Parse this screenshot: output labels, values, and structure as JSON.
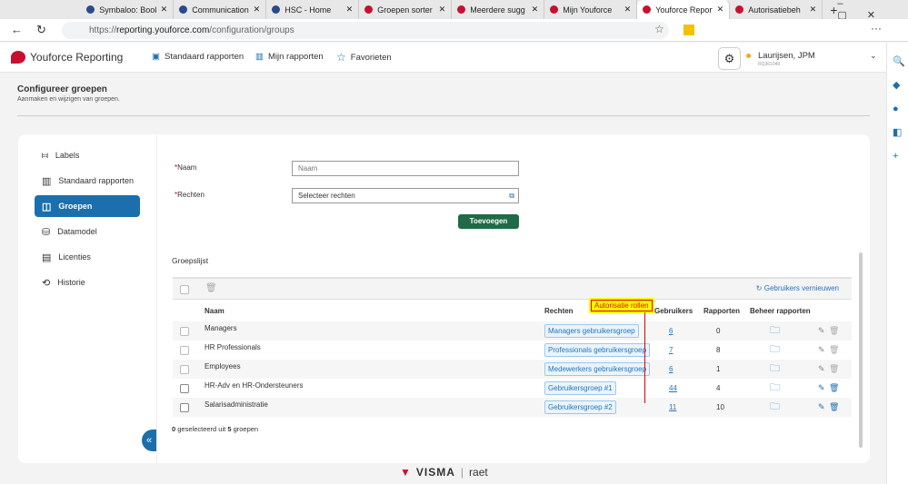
{
  "browser": {
    "tabs": [
      {
        "label": "Symbaloo: Book"
      },
      {
        "label": "Communication"
      },
      {
        "label": "HSC - Home"
      },
      {
        "label": "Groepen sorter"
      },
      {
        "label": "Meerdere sugg"
      },
      {
        "label": "Mijn Youforce"
      },
      {
        "label": "Youforce Report",
        "active": true
      },
      {
        "label": "Autorisatiebeh"
      }
    ],
    "url_prefix": "https://",
    "url_host": "reporting.youforce.com",
    "url_path": "/configuration/groups"
  },
  "app": {
    "logo": "Youforce Reporting",
    "nav": [
      "Standaard rapporten",
      "Mijn rapporten",
      "Favorieten"
    ],
    "user_name": "Laurijsen, JPM",
    "user_id": "RQ361049"
  },
  "page": {
    "title": "Configureer groepen",
    "subtitle": "Aanmaken en wijzigen van groepen."
  },
  "sidebar": {
    "items": [
      {
        "label": "Labels"
      },
      {
        "label": "Standaard rapporten"
      },
      {
        "label": "Groepen"
      },
      {
        "label": "Datamodel"
      },
      {
        "label": "Licenties"
      },
      {
        "label": "Historie"
      }
    ]
  },
  "form": {
    "name_label": "Naam",
    "name_placeholder": "Naam",
    "rights_label": "Rechten",
    "rights_placeholder": "Selecteer rechten",
    "required_mark": "*",
    "add_button": "Toevoegen"
  },
  "list": {
    "title": "Groepslijst",
    "refresh": "Gebruikers vernieuwen",
    "columns": [
      "Naam",
      "Rechten",
      "Gebruikers",
      "Rapporten",
      "Beheer rapporten"
    ],
    "rows": [
      {
        "name": "Managers",
        "rights": "Managers gebruikersgroep",
        "users": "6",
        "reports": "0"
      },
      {
        "name": "HR Professionals",
        "rights": "Professionals gebruikersgroep",
        "users": "7",
        "reports": "8"
      },
      {
        "name": "Employees",
        "rights": "Medewerkers gebruikersgroep",
        "users": "6",
        "reports": "1"
      },
      {
        "name": "HR-Adv en HR-Ondersteuners",
        "rights": "Gebruikersgroep #1",
        "users": "44",
        "reports": "4"
      },
      {
        "name": "Salarisadministratie",
        "rights": "Gebruikersgroep #2",
        "users": "11",
        "reports": "10"
      }
    ],
    "selected_count": "0",
    "selected_text": "geselecteerd uit",
    "total": "5",
    "total_text": "groepen"
  },
  "annotation": "Autorisatie rollen",
  "footer": {
    "brand": "VISMA",
    "sub": "raet"
  }
}
